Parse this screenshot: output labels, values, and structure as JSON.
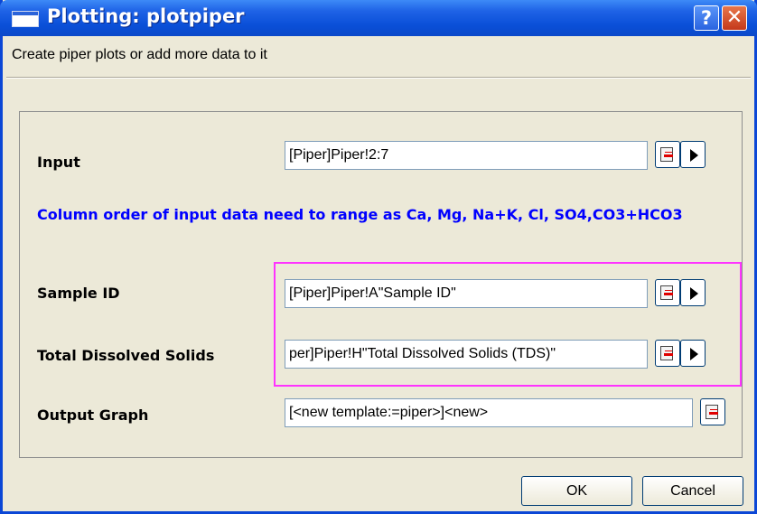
{
  "window": {
    "title": "Plotting: plotpiper",
    "help_label": "?",
    "close_label": "✕"
  },
  "description": "Create piper plots or add more data to it",
  "form": {
    "input": {
      "label": "Input",
      "value": "[Piper]Piper!2:7"
    },
    "note": "Column order of input data need to range as Ca, Mg, Na+K, Cl, SO4,CO3+HCO3",
    "sample_id": {
      "label": "Sample ID",
      "value": "[Piper]Piper!A\"Sample ID\""
    },
    "tds": {
      "label": "Total Dissolved Solids",
      "value": "per]Piper!H\"Total Dissolved Solids (TDS)\""
    },
    "output_graph": {
      "label": "Output Graph",
      "value": "[<new template:=piper>]<new>"
    }
  },
  "buttons": {
    "ok": "OK",
    "cancel": "Cancel"
  },
  "colors": {
    "titlebar": "#0a4fd8",
    "note_text": "#0000ff",
    "highlight": "#ff33ff",
    "dialog_bg": "#ece9d8"
  }
}
